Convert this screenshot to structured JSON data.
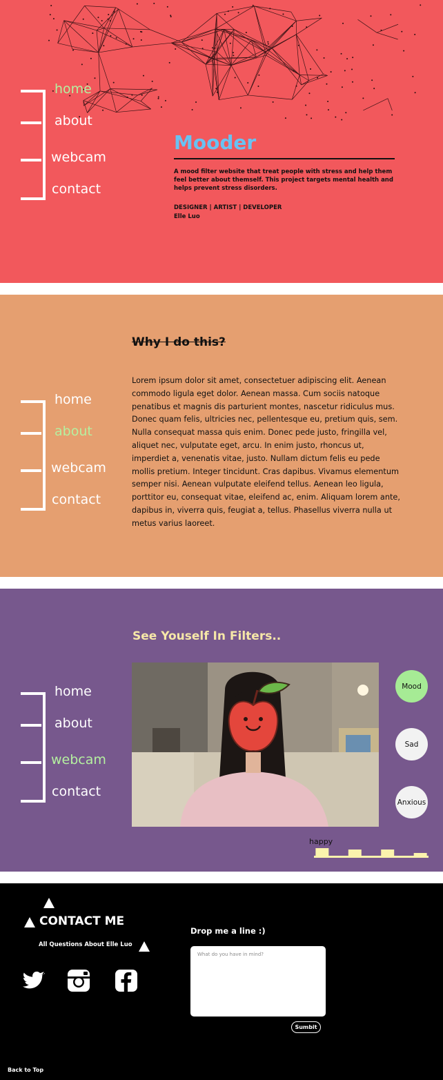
{
  "nav": {
    "items": [
      "home",
      "about",
      "webcam",
      "contact"
    ]
  },
  "hero": {
    "title": "Mooder",
    "description": "A mood filter website that treat people with stress and help them feel better about themself. This project targets mental health and helps prevent stress disorders.",
    "roles": "DESIGNER | ARTIST | DEVELOPER",
    "name": "Elle Luo"
  },
  "about": {
    "title": "Why I do this?",
    "body": "Lorem ipsum dolor sit amet, consectetuer adipiscing elit. Aenean commodo ligula eget dolor. Aenean massa. Cum sociis natoque penatibus et magnis dis parturient montes, nascetur ridiculus mus. Donec quam felis, ultricies nec, pellentesque eu, pretium quis, sem. Nulla consequat massa quis enim. Donec pede justo, fringilla vel, aliquet nec, vulputate eget, arcu. In enim justo, rhoncus ut, imperdiet a, venenatis vitae, justo. Nullam dictum felis eu pede mollis pretium. Integer tincidunt. Cras dapibus. Vivamus elementum semper nisi. Aenean vulputate eleifend tellus. Aenean leo ligula, porttitor eu, consequat vitae, eleifend ac, enim. Aliquam lorem ante, dapibus in, viverra quis, feugiat a, tellus. Phasellus viverra nulla ut metus varius laoreet."
  },
  "webcam": {
    "title": "See Youself In Filters..",
    "moods": [
      "Mood",
      "Sad",
      "Anxious"
    ],
    "active_mood": "Mood",
    "mood_label": "happy",
    "mood_levels": [
      0.55,
      0.0,
      0.45,
      0.0,
      0.45,
      0.0,
      0.2
    ]
  },
  "contact": {
    "title": "CONTACT ME",
    "subtitle": "All Questions About Elle Luo",
    "social": [
      "twitter-icon",
      "instagram-icon",
      "facebook-icon"
    ],
    "form_label": "Drop me a line :)",
    "message_placeholder": "What do you have in mind?",
    "submit_label": "Sumbit",
    "back_to_top": "Back to Top"
  },
  "colors": {
    "home_bg": "#f2585c",
    "about_bg": "#e59f70",
    "webcam_bg": "#77588d",
    "contact_bg": "#000000",
    "active_nav": "#b5f0a0",
    "hero_title": "#69c2f2",
    "webcam_title": "#f6e7a8",
    "mood_active": "#a6eb95",
    "mood_bar": "#fbf3ad"
  }
}
